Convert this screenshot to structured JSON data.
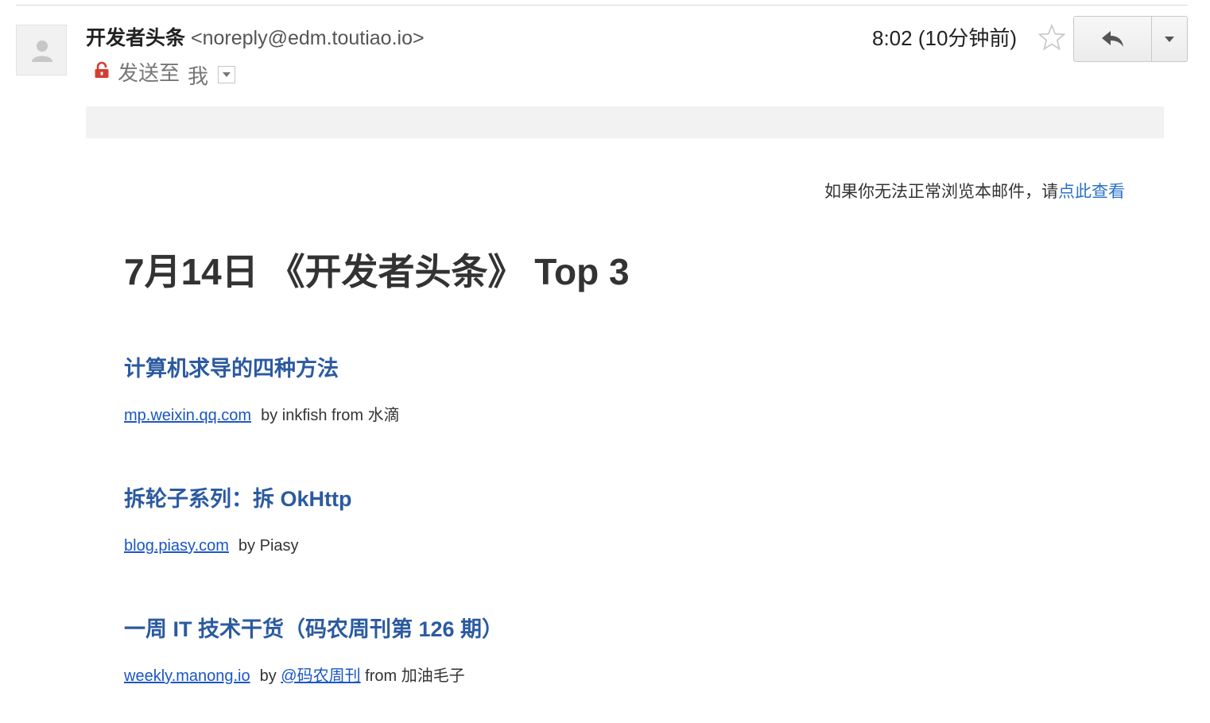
{
  "header": {
    "sender_name": "开发者头条",
    "sender_email": "<noreply@edm.toutiao.io>",
    "sent_to_label": "发送至",
    "recipient": "我",
    "timestamp": "8:02 (10分钟前)"
  },
  "banner": {
    "prefix": "如果你无法正常浏览本邮件，请",
    "link": "点此查看"
  },
  "email_title": "7月14日 《开发者头条》 Top 3",
  "articles": [
    {
      "title": "计算机求导的四种方法",
      "source": "mp.weixin.qq.com",
      "by": "by",
      "author": "inkfish",
      "from": "from",
      "origin": "水滴"
    },
    {
      "title": "拆轮子系列：拆 OkHttp",
      "source": "blog.piasy.com",
      "by": "by",
      "author": "Piasy"
    },
    {
      "title": "一周 IT 技术干货（码农周刊第 126 期）",
      "source": "weekly.manong.io",
      "by": "by",
      "author": "@码农周刊",
      "from": "from",
      "origin": "加油毛子"
    }
  ],
  "colors": {
    "link": "#1a56c4",
    "article_title": "#2b5aa0",
    "lock": "#d23f31"
  },
  "icons": {
    "avatar": "person-silhouette-icon",
    "lock": "lock-icon",
    "star": "star-outline-icon",
    "reply": "reply-arrow-icon",
    "more": "chevron-down-icon",
    "details": "details-dropdown-icon"
  }
}
